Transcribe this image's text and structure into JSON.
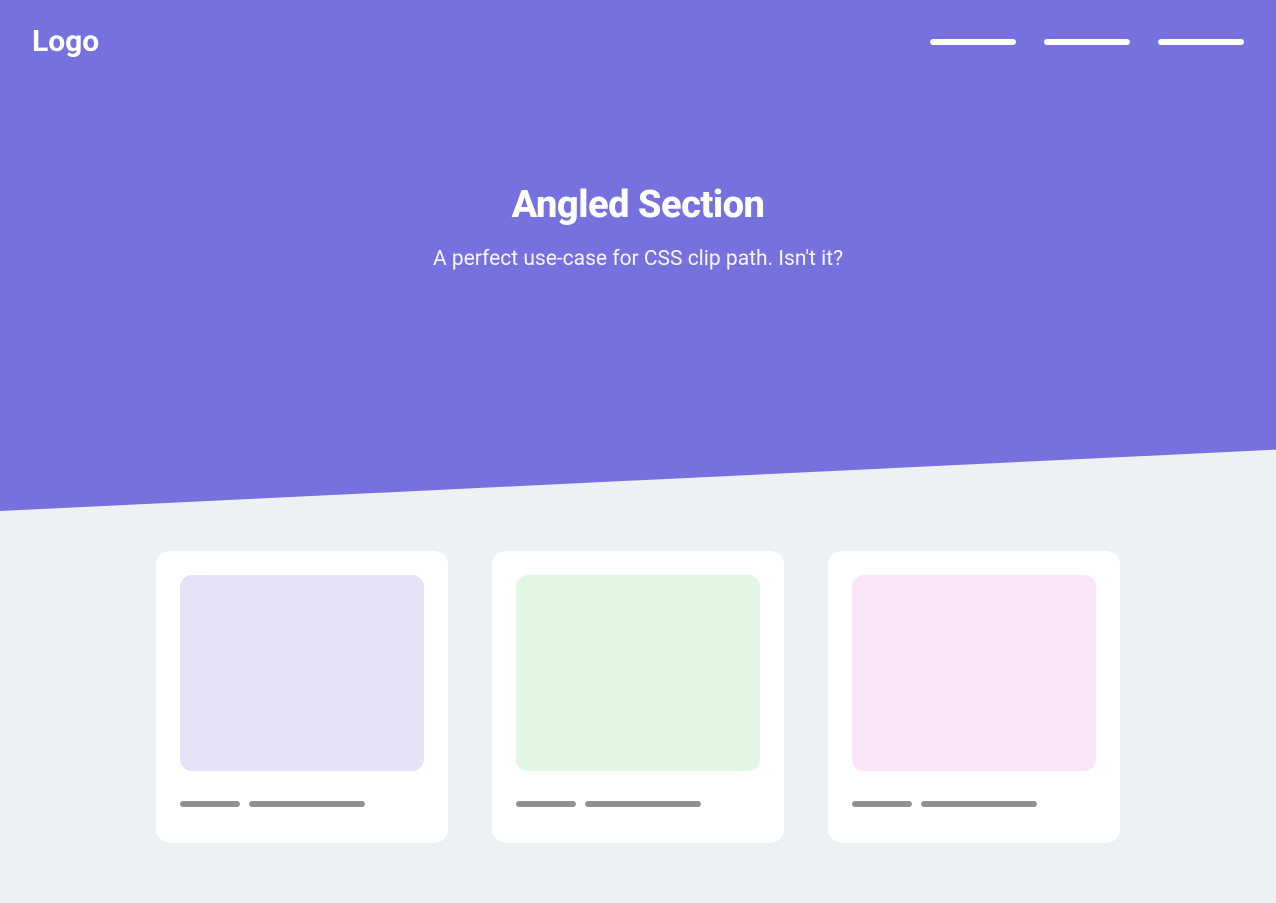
{
  "navbar": {
    "logo": "Logo"
  },
  "hero": {
    "title": "Angled Section",
    "subtitle": "A perfect use-case for CSS clip path. Isn't it?"
  },
  "cards": [
    {
      "image_color": "#e4e2f7"
    },
    {
      "image_color": "#e1f6e3"
    },
    {
      "image_color": "#f9e4fa"
    }
  ],
  "colors": {
    "primary": "#7671df",
    "background": "#eef1f3",
    "placeholder": "#919191"
  }
}
